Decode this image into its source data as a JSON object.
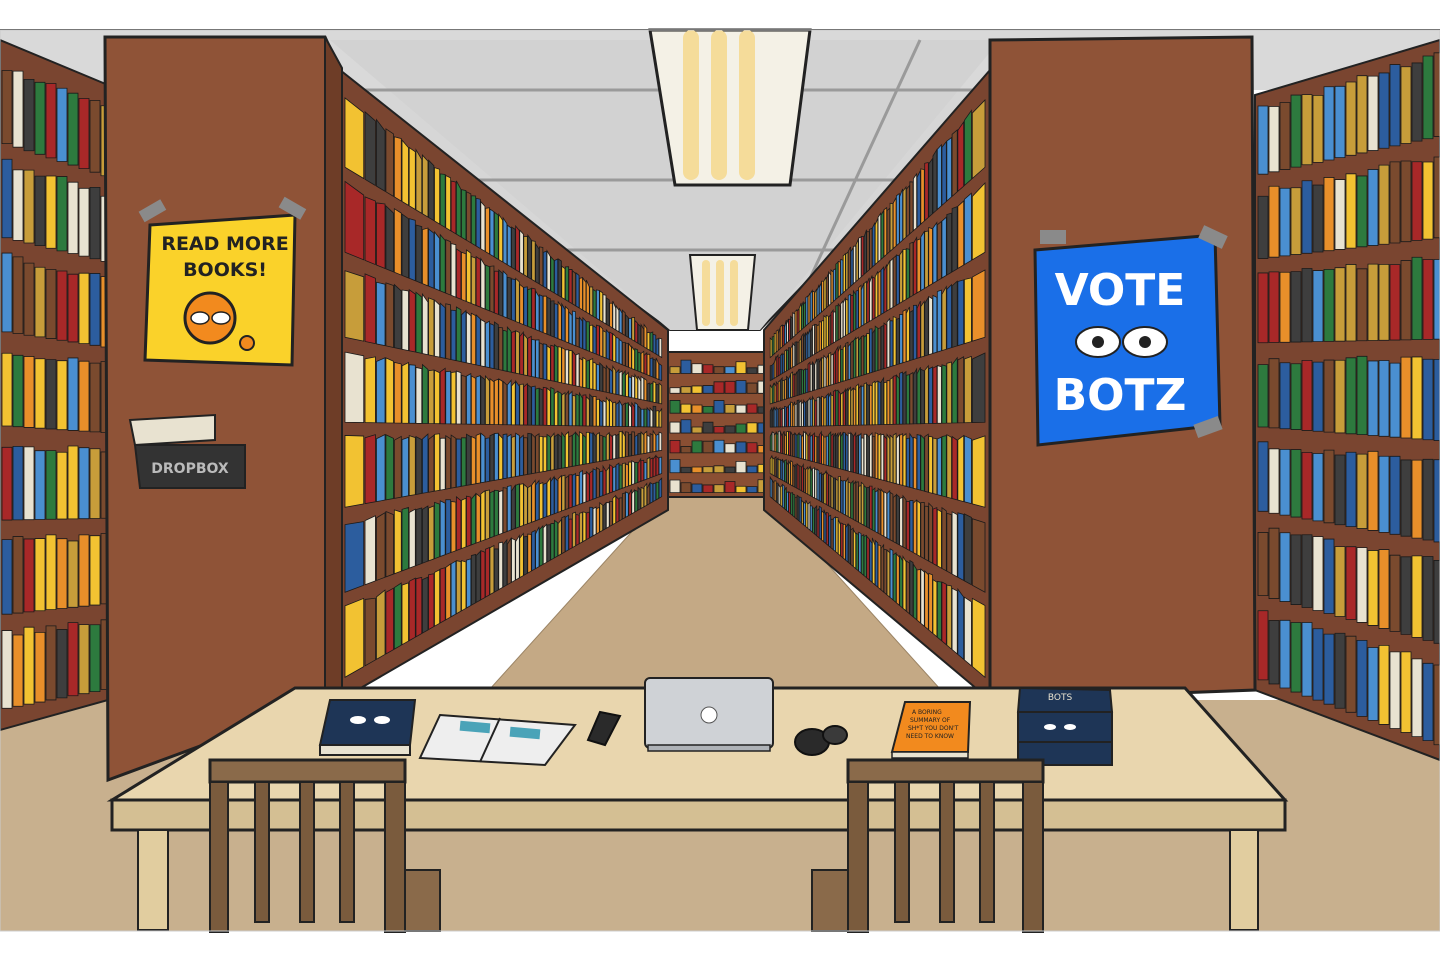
{
  "colors": {
    "frame": "#ffffff",
    "ceiling": "#d8d8d8",
    "beam": "#c9c9c9",
    "floor": "#c8b08e",
    "shelf_wood": "#8a4f33",
    "shelf_dark": "#6e3d27",
    "table": "#e9d6ae",
    "chair": "#8a6a4a",
    "poster_yellow": "#fad22a",
    "poster_blue": "#1a6fe8",
    "bot_orange": "#f28a1e",
    "book_palette": [
      "#2c5d9e",
      "#f2c232",
      "#2d7a3e",
      "#a82828",
      "#e88f2a",
      "#3e3e3e",
      "#e8e2d0",
      "#7a4a2e",
      "#4a8fd0",
      "#c79d3a"
    ]
  },
  "posters": {
    "left": {
      "line1": "READ MORE",
      "line2": "BOOKS!"
    },
    "right": {
      "line1": "VOTE",
      "line2": "BOTZ"
    }
  },
  "dropbox": {
    "label": "DROPBOX"
  },
  "desk_items": {
    "orange_book": {
      "line1": "A BORING",
      "line2": "SUMMARY OF",
      "line3": "SH*T YOU DON'T",
      "line4": "NEED TO KNOW"
    },
    "stacked_book": {
      "spine": "BOTS"
    }
  }
}
